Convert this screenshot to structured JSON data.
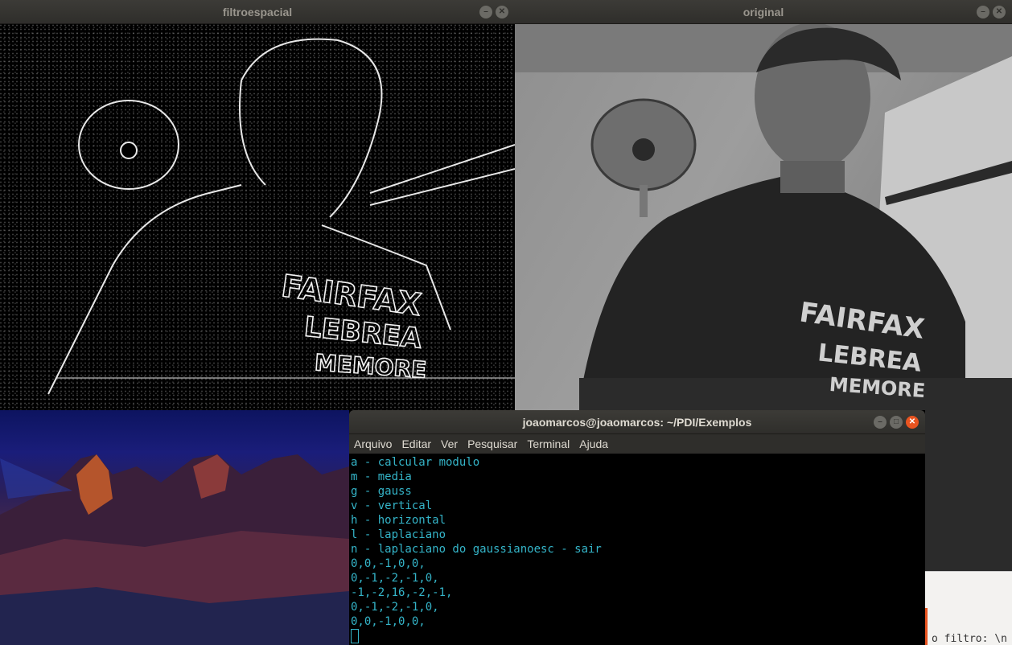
{
  "windows": {
    "filter": {
      "title": "filtroespacial"
    },
    "original": {
      "title": "original"
    },
    "terminal": {
      "title": "joaomarcos@joaomarcos: ~/PDI/Exemplos",
      "menu": [
        "Arquivo",
        "Editar",
        "Ver",
        "Pesquisar",
        "Terminal",
        "Ajuda"
      ],
      "lines": [
        "a - calcular modulo",
        "m - media",
        "g - gauss",
        "v - vertical",
        "h - horizontal",
        "l - laplaciano",
        "n - laplaciano do gaussianoesc - sair",
        "0,0,-1,0,0,",
        "0,-1,-2,-1,0,",
        "-1,-2,16,-2,-1,",
        "0,-1,-2,-1,0,",
        "0,0,-1,0,0,"
      ]
    },
    "background_editor": {
      "snippet": "o filtro: \\n"
    }
  },
  "image_text": {
    "shirt_line1": "FAIRFAX",
    "shirt_line2": "LEBREA",
    "shirt_line3": "MEMORE"
  },
  "colors": {
    "titlebar": "#3c3b37",
    "close_accent": "#e95420",
    "terminal_text": "#34b4c8"
  }
}
